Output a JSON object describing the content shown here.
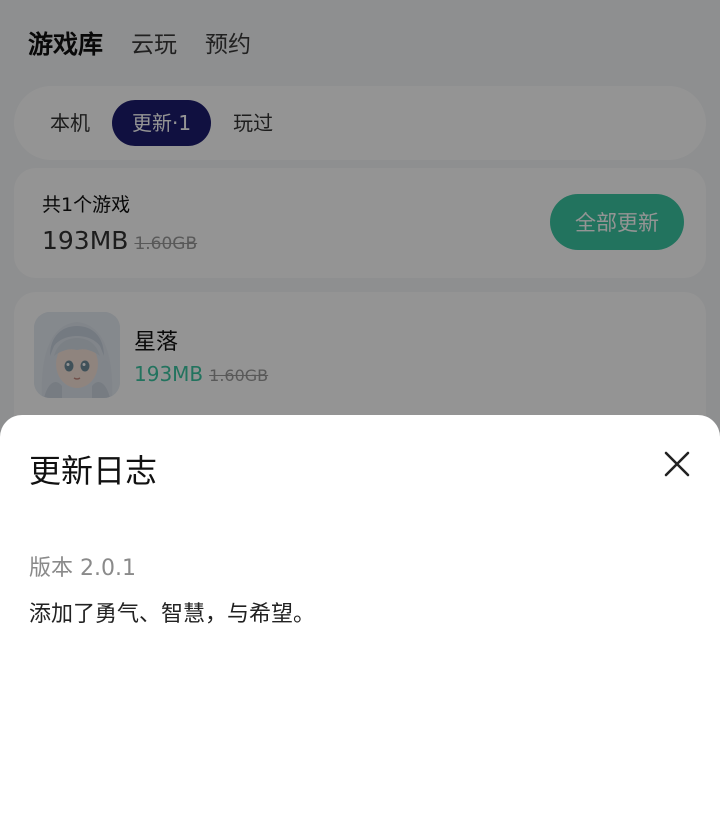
{
  "top_tabs": [
    "游戏库",
    "云玩",
    "预约"
  ],
  "segments": [
    "本机",
    "更新·1",
    "玩过"
  ],
  "summary": {
    "title": "共1个游戏",
    "size": "193MB",
    "original_size": "1.60GB",
    "update_all_label": "全部更新"
  },
  "game": {
    "name": "星落",
    "size": "193MB",
    "original_size": "1.60GB"
  },
  "sheet": {
    "title": "更新日志",
    "version": "版本 2.0.1",
    "changelog": "添加了勇气、智慧，与希望。"
  },
  "colors": {
    "accent": "#3cc6a3",
    "segment_active": "#1d1d6e",
    "scrim": "rgba(0,0,0,0.42)"
  },
  "icons": {
    "close": "close-icon",
    "game_icon": "game-icon"
  }
}
